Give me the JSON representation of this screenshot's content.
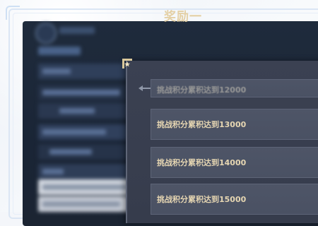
{
  "modal": {
    "title": "奖励一"
  },
  "reward_list": [
    {
      "label": "挑战积分累积达到12000",
      "state": "partially-visible"
    },
    {
      "label": "挑战积分累积达到13000",
      "state": "visible"
    },
    {
      "label": "挑战积分累积达到14000",
      "state": "visible"
    },
    {
      "label": "挑战积分累积达到15000",
      "state": "visible"
    }
  ],
  "icons": {
    "back_arrow": "arrow-left-icon",
    "corner_star": "star-corner-icon",
    "emblem": "game-emblem-icon"
  },
  "colors": {
    "modal_bg": "#3b4152",
    "item_bg": "#4e5567",
    "title_gold": "#e4d0a5",
    "item_text": "#e6d6b2",
    "background_navy": "#1f2b3c"
  }
}
